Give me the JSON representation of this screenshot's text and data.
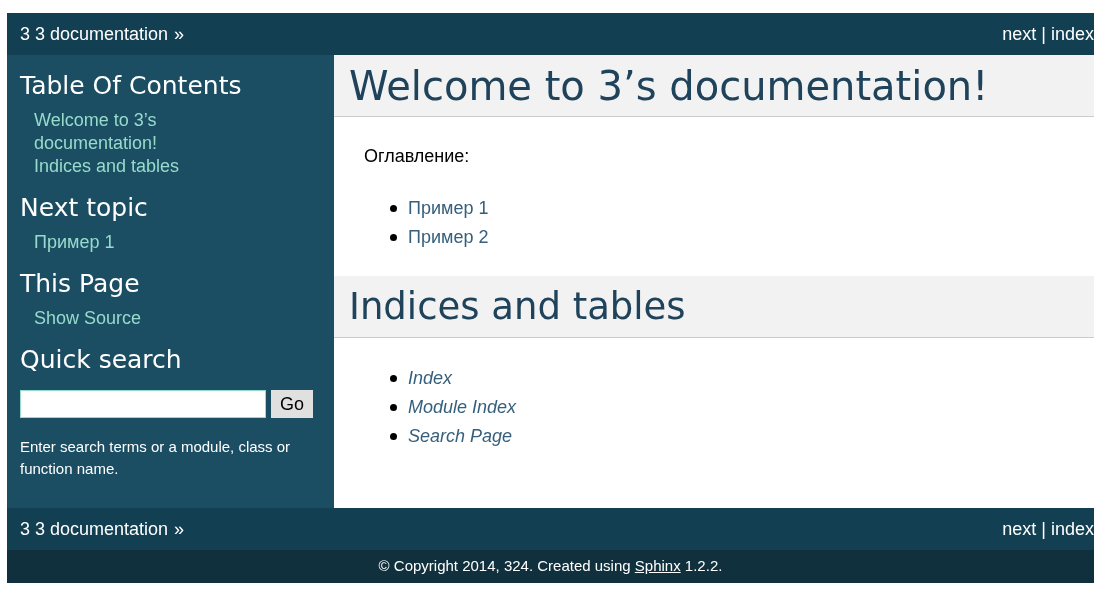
{
  "top_nav": {
    "home": "3 3 documentation",
    "arrow": "»",
    "links": [
      "next",
      "index"
    ],
    "separator": "|"
  },
  "sidebar": {
    "sections": [
      {
        "kind": "links",
        "title": "Table Of Contents",
        "items": [
          "Welcome to 3’s documentation!",
          "Indices and tables"
        ]
      },
      {
        "kind": "links",
        "title": "Next topic",
        "items": [
          "Пример 1"
        ]
      },
      {
        "kind": "links",
        "title": "This Page",
        "items": [
          "Show Source"
        ]
      },
      {
        "kind": "search",
        "title": "Quick search",
        "button": "Go",
        "help": "Enter search terms or a module, class or function name."
      }
    ]
  },
  "content": {
    "sections": [
      {
        "title": "Welcome to 3’s documentation!",
        "caption": "Оглавление:",
        "items": [
          {
            "label": "Пример 1",
            "emphasis": false
          },
          {
            "label": "Пример 2",
            "emphasis": false
          }
        ]
      },
      {
        "title": "Indices and tables",
        "items": [
          {
            "label": "Index",
            "emphasis": true
          },
          {
            "label": "Module Index",
            "emphasis": true
          },
          {
            "label": "Search Page",
            "emphasis": true
          }
        ]
      }
    ]
  },
  "bottom_nav": {
    "home": "3 3 documentation",
    "arrow": "»",
    "links": [
      "next",
      "index"
    ],
    "separator": "|"
  },
  "footer": {
    "before": "© Copyright 2014, 324. Created using",
    "link": "Sphinx",
    "after": "1.2.2."
  }
}
